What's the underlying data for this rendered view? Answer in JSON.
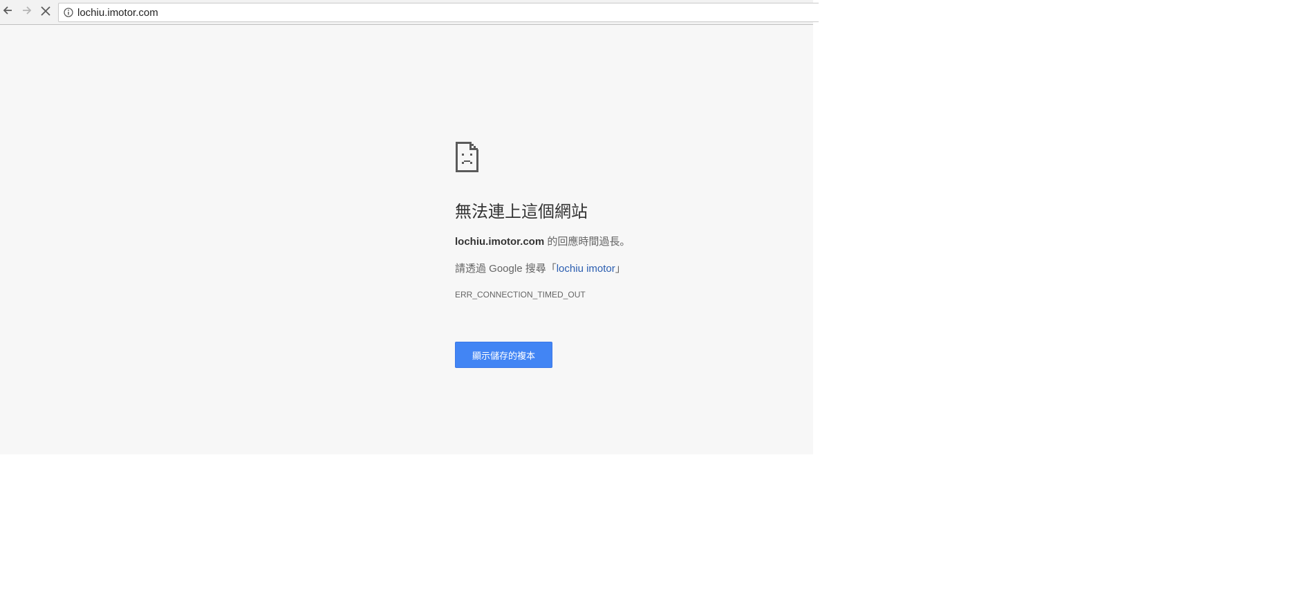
{
  "address_bar": {
    "url": "lochiu.imotor.com"
  },
  "icons": {
    "back": "arrow-left-icon",
    "forward": "arrow-right-icon",
    "stop": "close-icon",
    "site_info": "info-icon",
    "error": "sad-document-icon"
  },
  "error_page": {
    "title": "無法連上這個網站",
    "host": "lochiu.imotor.com",
    "message": " 的回應時間過長。",
    "suggest_prefix": "請透過 Google 搜尋「",
    "suggest_link": "lochiu imotor",
    "suggest_suffix": "」",
    "error_code": "ERR_CONNECTION_TIMED_OUT",
    "cached_button_label": "顯示儲存的複本"
  },
  "colors": {
    "page_background": "#f7f7f7",
    "button_blue": "#4285f4",
    "link_blue": "#2a5db0"
  }
}
